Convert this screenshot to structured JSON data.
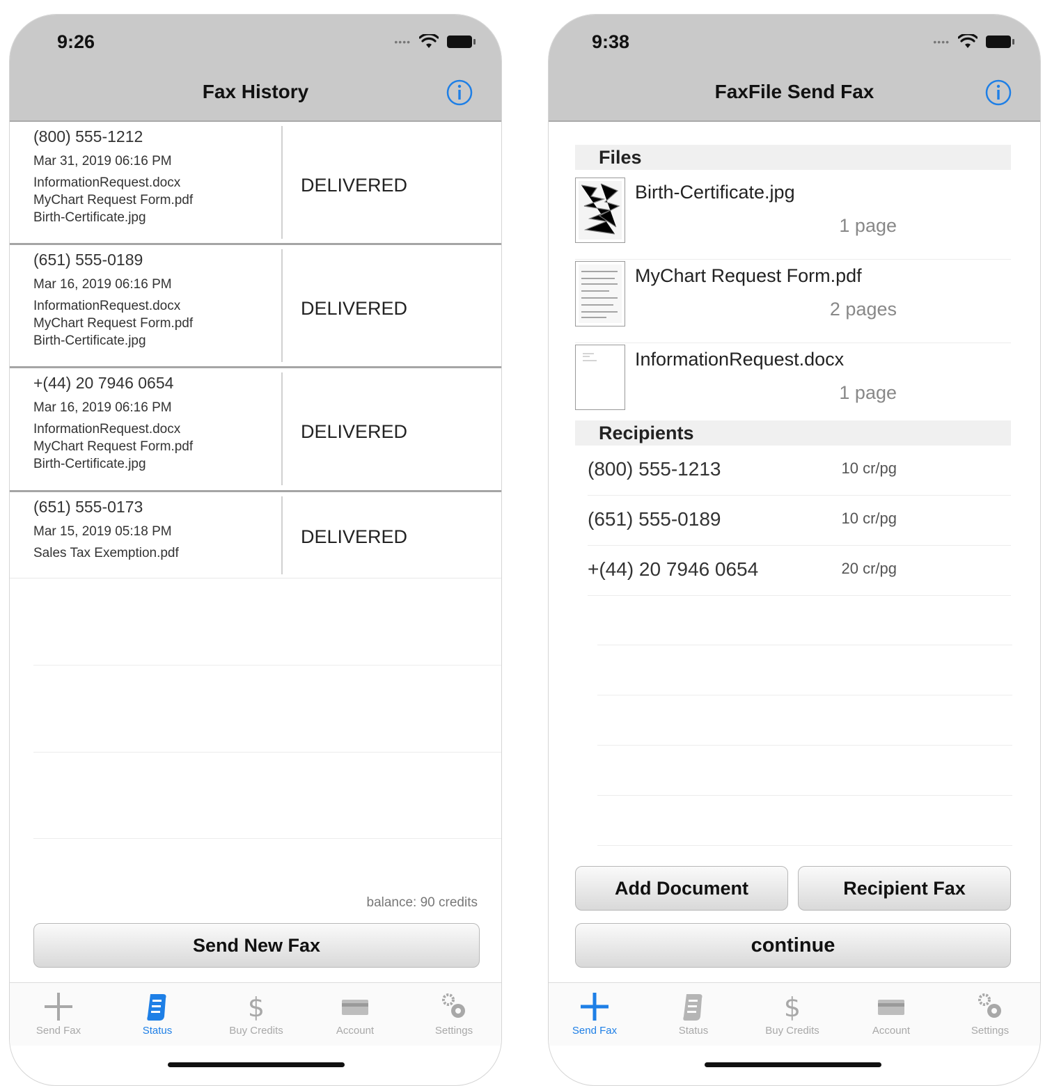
{
  "left_phone": {
    "time": "9:26",
    "title": "Fax History",
    "faxes": [
      {
        "number": "(800) 555-1212",
        "date": "Mar 31, 2019 06:16 PM",
        "files": [
          "InformationRequest.docx",
          "MyChart Request Form.pdf",
          "Birth-Certificate.jpg"
        ],
        "status": "DELIVERED"
      },
      {
        "number": "(651) 555-0189",
        "date": "Mar 16, 2019 06:16 PM",
        "files": [
          "InformationRequest.docx",
          "MyChart Request Form.pdf",
          "Birth-Certificate.jpg"
        ],
        "status": "DELIVERED"
      },
      {
        "number": "+(44) 20 7946 0654",
        "date": "Mar 16, 2019 06:16 PM",
        "files": [
          "InformationRequest.docx",
          "MyChart Request Form.pdf",
          "Birth-Certificate.jpg"
        ],
        "status": "DELIVERED"
      },
      {
        "number": "(651) 555-0173",
        "date": "Mar 15, 2019 05:18 PM",
        "files": [
          "Sales Tax Exemption.pdf"
        ],
        "status": "DELIVERED"
      }
    ],
    "balance": "balance: 90 credits",
    "send_new_fax_label": "Send New Fax",
    "active_tab": "Status"
  },
  "right_phone": {
    "time": "9:38",
    "title": "FaxFile Send Fax",
    "files_header": "Files",
    "files": [
      {
        "name": "Birth-Certificate.jpg",
        "pages": "1 page"
      },
      {
        "name": "MyChart Request Form.pdf",
        "pages": "2 pages"
      },
      {
        "name": "InformationRequest.docx",
        "pages": "1 page"
      }
    ],
    "recipients_header": "Recipients",
    "recipients": [
      {
        "number": "(800) 555-1213",
        "rate": "10 cr/pg"
      },
      {
        "number": "(651) 555-0189",
        "rate": "10 cr/pg"
      },
      {
        "number": "+(44) 20 7946 0654",
        "rate": "20 cr/pg"
      }
    ],
    "add_document_label": "Add Document",
    "recipient_fax_label": "Recipient Fax",
    "continue_label": "continue",
    "active_tab": "Send Fax"
  },
  "tabs": [
    {
      "label": "Send Fax",
      "icon": "plus-icon"
    },
    {
      "label": "Status",
      "icon": "scroll-icon"
    },
    {
      "label": "Buy Credits",
      "icon": "dollar-icon"
    },
    {
      "label": "Account",
      "icon": "card-icon"
    },
    {
      "label": "Settings",
      "icon": "gears-icon"
    }
  ],
  "colors": {
    "accent": "#1e7fe6",
    "nav_bar": "#c9c9c9",
    "tab_inactive": "#a8a8a8"
  }
}
